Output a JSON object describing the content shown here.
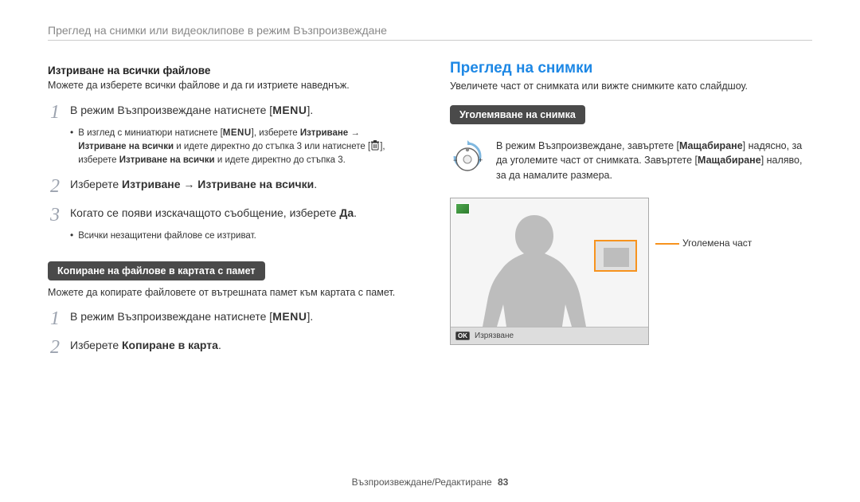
{
  "header": {
    "breadcrumb": "Преглед на снимки или видеоклипове в режим Възпроизвеждане"
  },
  "left": {
    "delete_all_heading": "Изтриване на всички файлове",
    "delete_all_desc": "Можете да изберете всички файлове и да ги изтриете наведнъж.",
    "step1_prefix": "В режим Възпроизвеждане натиснете [",
    "menu_word": "MENU",
    "step1_suffix": "].",
    "bullet1_a": "В изглед с миниатюри натиснете [",
    "bullet1_b": "], изберете ",
    "bullet1_delete": "Изтриване",
    "bullet1_arrow": " → ",
    "bullet1_delete_all": "Изтриване на всички",
    "bullet1_c": " и идете директно до стъпка 3 или натиснете [",
    "bullet1_d": "], изберете ",
    "bullet1_e": " и идете директно до стъпка 3.",
    "step2_a": "Изберете ",
    "step2_b": "Изтриване",
    "step2_c": " → ",
    "step2_d": "Изтриване на всички",
    "step2_e": ".",
    "step3_a": "Когато се появи изскачащото съобщение, изберете ",
    "step3_b": "Да",
    "step3_c": ".",
    "bullet2": "Всички незащитени файлове се изтриват.",
    "copy_pill": "Копиране на файлове в картата с памет",
    "copy_desc": "Можете да копирате файловете от вътрешната памет към картата с памет.",
    "copy_step1_a": "В режим Възпроизвеждане натиснете [",
    "copy_step1_b": "].",
    "copy_step2_a": "Изберете ",
    "copy_step2_b": "Копиране в карта",
    "copy_step2_c": "."
  },
  "right": {
    "section_title": "Преглед на снимки",
    "section_desc": "Увеличете част от снимката или вижте снимките като слайдшоу.",
    "zoom_pill": "Уголемяване на снимка",
    "zoom_text_a": "В режим Възпроизвеждане, завъртете [",
    "zoom_bold": "Мащабиране",
    "zoom_text_b": "] надясно, за да уголемите част от снимката. Завъртете [",
    "zoom_text_c": "] наляво, за да намалите размера.",
    "callout_label": "Уголемена част",
    "preview_footer": "Изрязване",
    "ok_label": "OK"
  },
  "footer": {
    "text": "Възпроизвеждане/Редактиране",
    "page": "83"
  }
}
